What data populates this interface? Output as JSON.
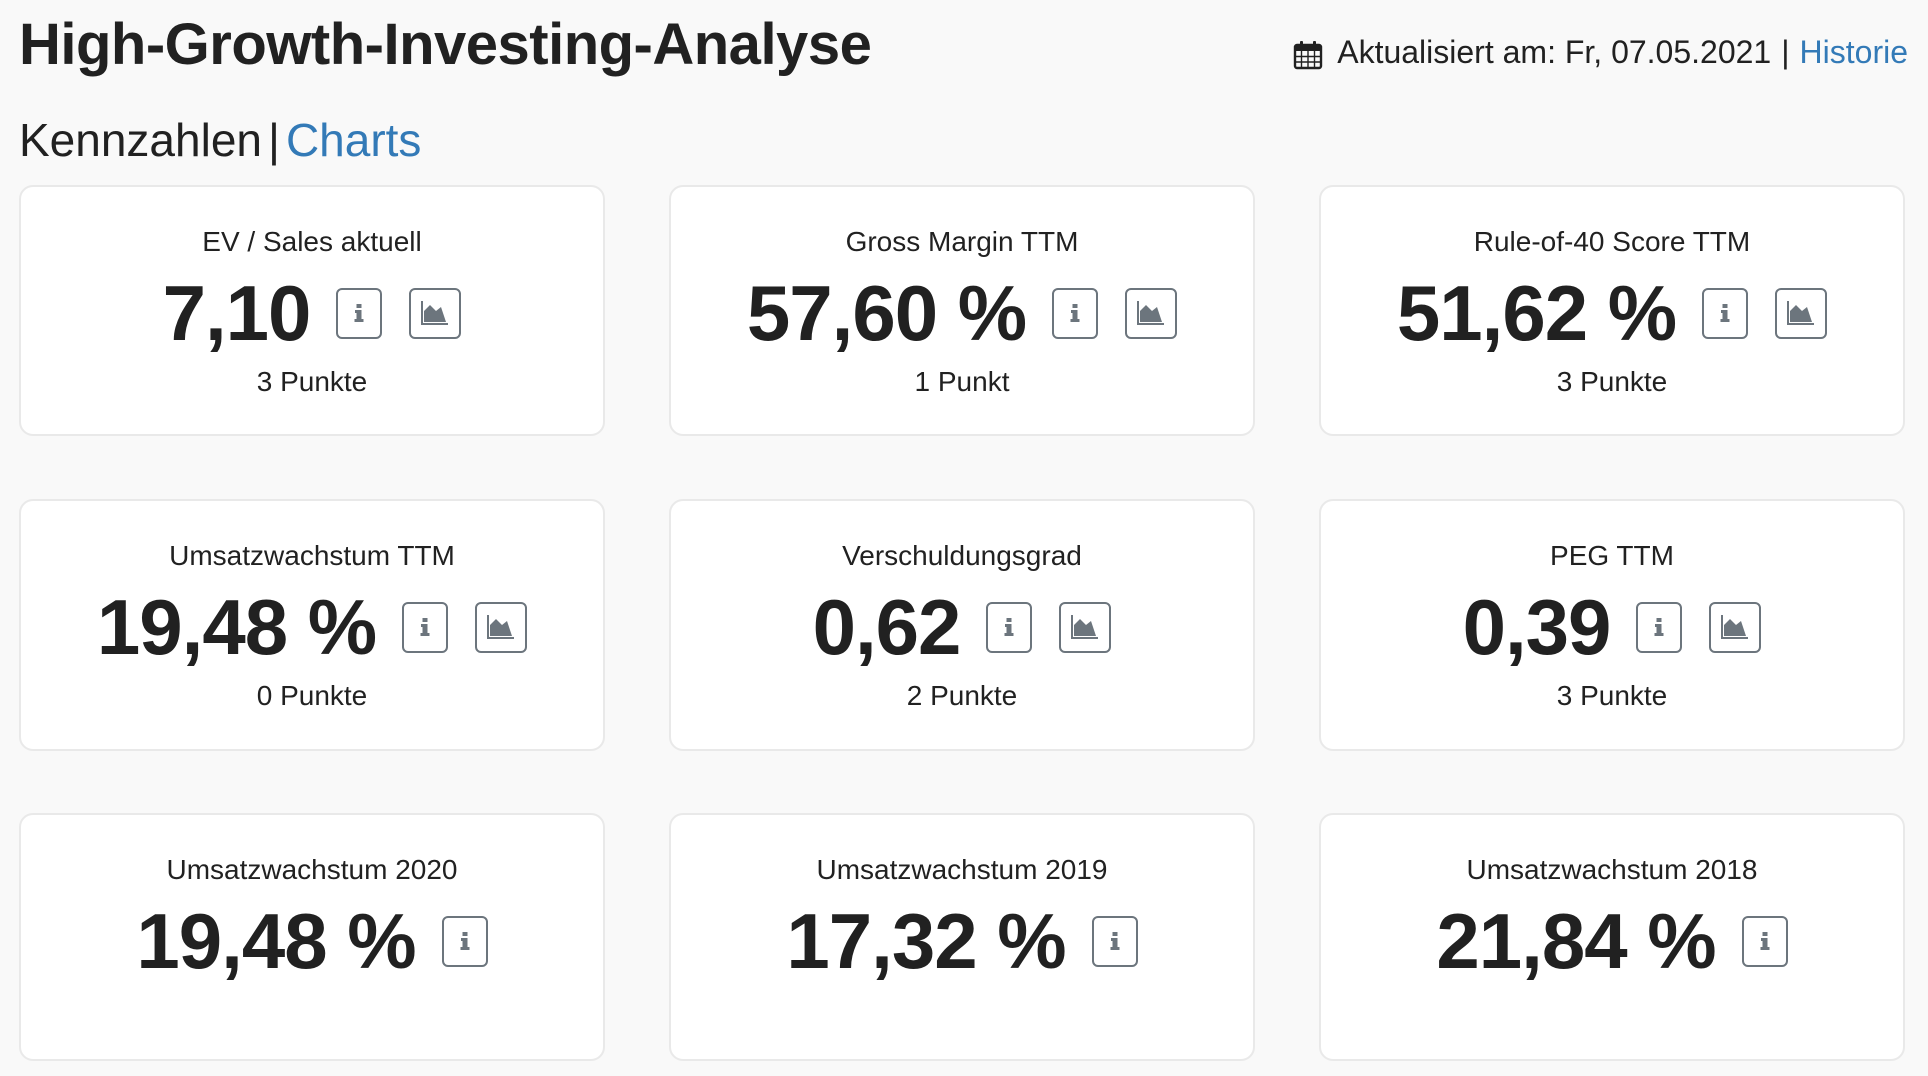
{
  "header": {
    "title": "High-Growth-Investing-Analyse",
    "updated_label": "Aktualisiert am: Fr, 07.05.2021",
    "separator": "|",
    "history_link": "Historie",
    "calendar_icon": "calendar-icon"
  },
  "section": {
    "title": "Kennzahlen",
    "separator": "|",
    "charts_link": "Charts"
  },
  "colors": {
    "link": "#337ab7",
    "icon_button": "#6c757d",
    "background": "#f9f9f9"
  },
  "cards": [
    {
      "title": "EV / Sales aktuell",
      "value": "7,10",
      "points": "3 Punkte",
      "has_chart": true
    },
    {
      "title": "Gross Margin TTM",
      "value": "57,60 %",
      "points": "1 Punkt",
      "has_chart": true
    },
    {
      "title": "Rule-of-40 Score TTM",
      "value": "51,62 %",
      "points": "3 Punkte",
      "has_chart": true
    },
    {
      "title": "Umsatzwachstum TTM",
      "value": "19,48 %",
      "points": "0 Punkte",
      "has_chart": true
    },
    {
      "title": "Verschuldungsgrad",
      "value": "0,62",
      "points": "2 Punkte",
      "has_chart": true
    },
    {
      "title": "PEG TTM",
      "value": "0,39",
      "points": "3 Punkte",
      "has_chart": true
    },
    {
      "title": "Umsatzwachstum 2020",
      "value": "19,48 %",
      "points": "",
      "has_chart": false
    },
    {
      "title": "Umsatzwachstum 2019",
      "value": "17,32 %",
      "points": "",
      "has_chart": false
    },
    {
      "title": "Umsatzwachstum 2018",
      "value": "21,84 %",
      "points": "",
      "has_chart": false
    }
  ]
}
